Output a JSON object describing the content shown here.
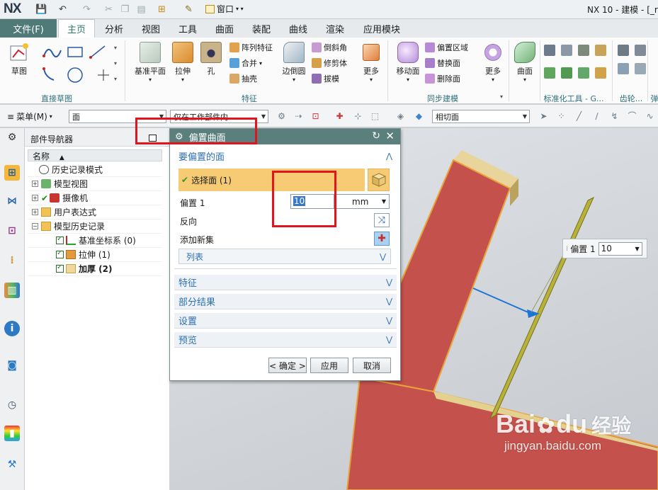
{
  "titlebar": {
    "logo": "NX",
    "window_menu": "窗口",
    "title": "NX 10 - 建模 - [_r"
  },
  "tabs": {
    "file": "文件(F)",
    "items": [
      "主页",
      "分析",
      "视图",
      "工具",
      "曲面",
      "装配",
      "曲线",
      "渲染",
      "应用模块"
    ],
    "active": "主页"
  },
  "ribbon": {
    "sketch": {
      "btn": "草图",
      "group": "直接草图"
    },
    "feature": {
      "datum_plane": "基准平面",
      "extrude": "拉伸",
      "hole": "孔",
      "pattern": "阵列特征",
      "unite": "合并",
      "shell": "抽壳",
      "edge_blend": "边倒圆",
      "chamfer": "倒斜角",
      "trim_body": "修剪体",
      "draft": "拔模",
      "more": "更多",
      "group": "特征"
    },
    "sync": {
      "move_face": "移动面",
      "offset_region": "偏置区域",
      "replace_face": "替换面",
      "delete_face": "删除面",
      "more": "更多",
      "group": "同步建模"
    },
    "surface": {
      "btn": "曲面"
    },
    "std_tools": {
      "group": "标准化工具 - G..."
    },
    "gear": {
      "group": "齿轮..."
    },
    "trailing_group": "弹"
  },
  "selection_bar": {
    "menu": "菜单(M)",
    "filter": "面",
    "scope": "仅在工作部件内",
    "face_rule": "相切面"
  },
  "navigator": {
    "title": "部件导航器",
    "column": "名称",
    "rows": [
      {
        "label": "历史记录模式"
      },
      {
        "label": "模型视图"
      },
      {
        "label": "摄像机"
      },
      {
        "label": "用户表达式"
      },
      {
        "label": "模型历史记录"
      },
      {
        "label": "基准坐标系 (0)"
      },
      {
        "label": "拉伸 (1)"
      },
      {
        "label": "加厚 (2)"
      }
    ]
  },
  "dialog": {
    "title": "偏置曲面",
    "section_faces": "要偏置的面",
    "select_face": "选择面 (1)",
    "offset_label": "偏置 1",
    "offset_value": "10",
    "unit": "mm",
    "reverse": "反向",
    "add_set": "添加新集",
    "list": "列表",
    "sections": [
      "特征",
      "部分结果",
      "设置",
      "预览"
    ],
    "buttons": {
      "ok": "< 确定 >",
      "apply": "应用",
      "cancel": "取消"
    }
  },
  "float": {
    "label": "偏置 1",
    "value": "10"
  },
  "watermark": {
    "brand": "Bai",
    "paw": "du",
    "jingyan": "经验",
    "url": "jingyan.baidu.com"
  },
  "colors": {
    "accent": "#5a7f7d",
    "highlight": "#f7cb73",
    "annotation": "#e0151d",
    "solid": "#c4514b"
  }
}
